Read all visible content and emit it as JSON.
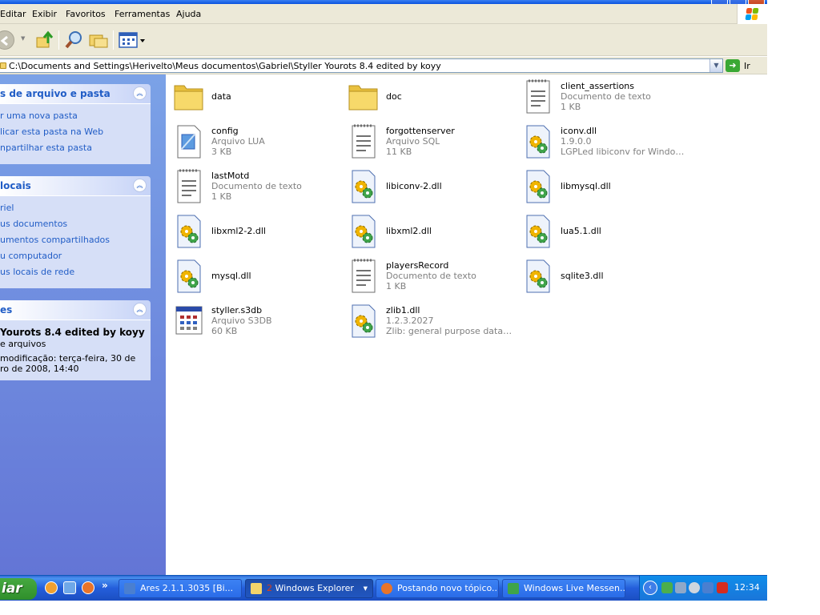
{
  "menubar": {
    "items": [
      "Editar",
      "Exibir",
      "Favoritos",
      "Ferramentas",
      "Ajuda"
    ]
  },
  "toolbar": {
    "icons": [
      "back-icon",
      "forward-icon",
      "up-folder-icon",
      "search-icon",
      "folders-icon",
      "views-icon"
    ]
  },
  "address": {
    "path": "C:\\Documents and Settings\\Herivelto\\Meus documentos\\Gabriel\\Styller Yourots 8.4 edited by koyy",
    "go_label": "Ir"
  },
  "leftpane": {
    "tasks": {
      "title": "s de arquivo e pasta",
      "items": [
        "r uma nova pasta",
        "licar esta pasta na Web",
        "npartilhar esta pasta"
      ]
    },
    "places": {
      "title": "locais",
      "items": [
        "riel",
        "us documentos",
        "umentos compartilhados",
        "u computador",
        "us locais de rede"
      ]
    },
    "details": {
      "title": "es",
      "name": "Yourots 8.4 edited by koyy",
      "type": "e arquivos",
      "modified_line1": "modificação: terça-feira, 30 de",
      "modified_line2": "ro de 2008, 14:40"
    }
  },
  "files": [
    {
      "name": "data",
      "line2": "",
      "line3": "",
      "icon": "folder"
    },
    {
      "name": "doc",
      "line2": "",
      "line3": "",
      "icon": "folder"
    },
    {
      "name": "client_assertions",
      "line2": "Documento de texto",
      "line3": "1 KB",
      "icon": "text"
    },
    {
      "name": "config",
      "line2": "Arquivo LUA",
      "line3": "3 KB",
      "icon": "lua"
    },
    {
      "name": "forgottenserver",
      "line2": "Arquivo SQL",
      "line3": "11 KB",
      "icon": "text"
    },
    {
      "name": "iconv.dll",
      "line2": "1.9.0.0",
      "line3": "LGPLed libiconv for Windows N...",
      "icon": "dll"
    },
    {
      "name": "lastMotd",
      "line2": "Documento de texto",
      "line3": "1 KB",
      "icon": "text"
    },
    {
      "name": "libiconv-2.dll",
      "line2": "",
      "line3": "",
      "icon": "dll"
    },
    {
      "name": "libmysql.dll",
      "line2": "",
      "line3": "",
      "icon": "dll"
    },
    {
      "name": "libxml2-2.dll",
      "line2": "",
      "line3": "",
      "icon": "dll"
    },
    {
      "name": "libxml2.dll",
      "line2": "",
      "line3": "",
      "icon": "dll"
    },
    {
      "name": "lua5.1.dll",
      "line2": "",
      "line3": "",
      "icon": "dll"
    },
    {
      "name": "mysql.dll",
      "line2": "",
      "line3": "",
      "icon": "dll"
    },
    {
      "name": "playersRecord",
      "line2": "Documento de texto",
      "line3": "1 KB",
      "icon": "text"
    },
    {
      "name": "sqlite3.dll",
      "line2": "",
      "line3": "",
      "icon": "dll"
    },
    {
      "name": "styller.s3db",
      "line2": "Arquivo S3DB",
      "line3": "60 KB",
      "icon": "s3db"
    },
    {
      "name": "zlib1.dll",
      "line2": "1.2.3.2027",
      "line3": "Zlib: general purpose data co...",
      "icon": "dll"
    }
  ],
  "taskbar": {
    "start_label": "iar",
    "more_label": "»",
    "tasks": [
      {
        "label": "Ares 2.1.1.3035  [Bi...",
        "icon": "ares-icon",
        "active": false
      },
      {
        "label": "Windows Explorer",
        "count": "2",
        "icon": "folder-icon",
        "active": true
      },
      {
        "label": "Postando novo tópico...",
        "icon": "firefox-icon",
        "active": false
      },
      {
        "label": "Windows Live Messen...",
        "icon": "messenger-icon",
        "active": false
      }
    ],
    "clock": "12:34"
  },
  "colors": {
    "xp_blue": "#245edb",
    "pane_blue": "#6375d6",
    "start_green": "#3a9a33",
    "folder_yellow": "#f3d36b",
    "link_blue": "#215dc6"
  }
}
